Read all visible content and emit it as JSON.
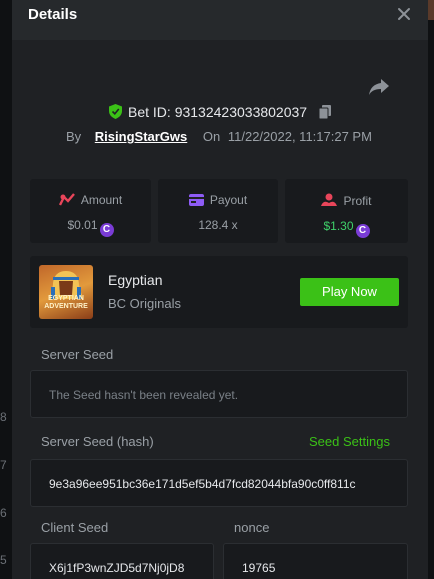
{
  "modal": {
    "title": "Details"
  },
  "backdrop": {
    "numbers": [
      "8",
      "7",
      "6",
      "5"
    ]
  },
  "bet": {
    "id_label": "Bet ID:",
    "id": "93132423033802037",
    "by_label": "By",
    "user": "RisingStarGws",
    "on_label": "On",
    "date": "11/22/2022, 11:17:27 PM"
  },
  "stats": {
    "amount": {
      "label": "Amount",
      "value": "$0.01"
    },
    "payout": {
      "label": "Payout",
      "value": "128.4 x"
    },
    "profit": {
      "label": "Profit",
      "value": "$1.30"
    }
  },
  "game": {
    "name": "Egyptian",
    "provider": "BC Originals",
    "thumb_text": "EGYPTIAN ADVENTURE",
    "play_label": "Play Now"
  },
  "fairness": {
    "server_seed_label": "Server Seed",
    "server_seed_value": "The Seed hasn't been revealed yet.",
    "server_hash_label": "Server Seed (hash)",
    "seed_settings_label": "Seed Settings",
    "server_hash_value": "9e3a96ee951bc36e171d5ef5b4d7fcd82044bfa90c0ff811c",
    "client_seed_label": "Client Seed",
    "client_seed_value": "X6j1fP3wnZJD5d7Nj0jD8",
    "nonce_label": "nonce",
    "nonce_value": "19765"
  },
  "colors": {
    "accent_green": "#3bc117",
    "profit_green": "#3fd16a",
    "coin_purple": "#7a3cd6",
    "icon_red": "#e8455a",
    "icon_purple": "#8e5cf6"
  }
}
